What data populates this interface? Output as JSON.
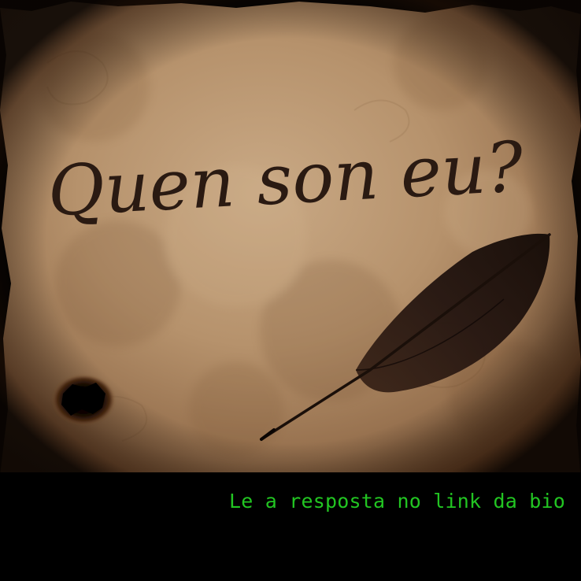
{
  "image": {
    "handwritten_title": "Quen son eu?",
    "caption": "Le a resposta no link da bio",
    "colors": {
      "parchment_light": "#c3a27e",
      "parchment_mid": "#a98561",
      "parchment_dark": "#5a3a20",
      "ink": "#2a1a12",
      "caption_green": "#22c522",
      "background": "#000000"
    },
    "objects": [
      "parchment",
      "feather-quill",
      "burn-hole",
      "handwritten-text"
    ]
  }
}
